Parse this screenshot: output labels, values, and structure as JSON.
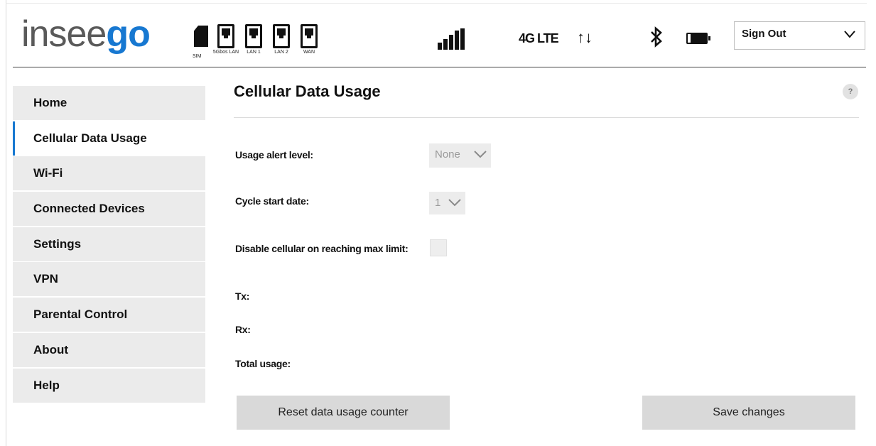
{
  "header": {
    "logo_part1": "insee",
    "logo_part2": "go",
    "ports": [
      {
        "name": "sim",
        "label": "SIM"
      },
      {
        "name": "5gbps-lan",
        "label": "5Gbos LAN"
      },
      {
        "name": "lan1",
        "label": "LAN 1"
      },
      {
        "name": "lan2",
        "label": "LAN 2"
      },
      {
        "name": "wan",
        "label": "WAN"
      }
    ],
    "network_type": "4G LTE",
    "transfer_arrows": "↑↓",
    "signout_label": "Sign Out"
  },
  "sidebar": {
    "items": [
      {
        "label": "Home",
        "active": false
      },
      {
        "label": "Cellular Data Usage",
        "active": true
      },
      {
        "label": "Wi-Fi",
        "active": false
      },
      {
        "label": "Connected Devices",
        "active": false
      },
      {
        "label": "Settings",
        "active": false
      },
      {
        "label": "VPN",
        "active": false
      },
      {
        "label": "Parental Control",
        "active": false
      },
      {
        "label": "About",
        "active": false
      },
      {
        "label": "Help",
        "active": false
      }
    ]
  },
  "main": {
    "title": "Cellular Data Usage",
    "help_label": "?",
    "usage_alert_label": "Usage alert level:",
    "usage_alert_value": "None",
    "cycle_start_label": "Cycle start date:",
    "cycle_start_value": "1",
    "disable_cellular_label": "Disable cellular on reaching max limit:",
    "disable_cellular_checked": false,
    "tx_label": "Tx:",
    "rx_label": "Rx:",
    "total_usage_label": "Total usage:",
    "reset_button_label": "Reset data usage counter",
    "save_button_label": "Save changes"
  },
  "colors": {
    "accent": "#1778d1",
    "nav_bg": "#ebebeb",
    "button_bg": "#d9d9d9"
  }
}
